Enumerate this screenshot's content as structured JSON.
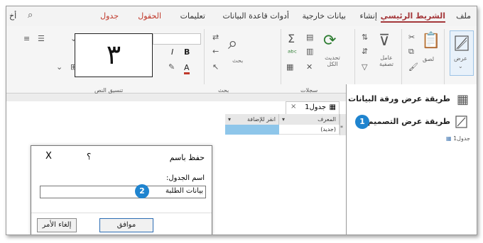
{
  "tabs": [
    "ملف",
    "الشريط الرئيسي",
    "إنشاء",
    "بيانات خارجية",
    "أدوات قاعدة البيانات",
    "تعليمات",
    "الحقول",
    "جدول",
    "أخ"
  ],
  "ribbon": {
    "view_label": "عرض",
    "paste_label": "لصق",
    "filter_label": "عامل تصفية",
    "refresh_label": "تحديث الكل",
    "find_label": "بحث",
    "group_records": "سجلات",
    "group_find": "بحث",
    "group_text_format": "تنسيق النص",
    "bold": "B",
    "italic": "I",
    "underline": "A"
  },
  "overlay_number": "٣",
  "document_tab": "جدول1",
  "grid": {
    "col_id": "المعرف",
    "col_add": "انقر للإضافة",
    "new_row": "(جديد)"
  },
  "view_menu": {
    "datasheet": "طريقة عرض ورقة البيانات",
    "design": "طريقة عرض التصميم",
    "nav_item": "جدول1"
  },
  "dialog": {
    "title": "حفظ باسم",
    "help": "؟",
    "close": "X",
    "table_name_label": "اسم الجدول:",
    "table_name_value": "بيانات الطلبة",
    "ok": "موافق",
    "cancel": "إلغاء الأمر"
  },
  "badges": {
    "step1": "1",
    "step2": "2"
  },
  "colors": {
    "accent_red": "#a4373a",
    "badge_blue": "#1f84cf",
    "selected_cell": "#8ec6ea"
  }
}
